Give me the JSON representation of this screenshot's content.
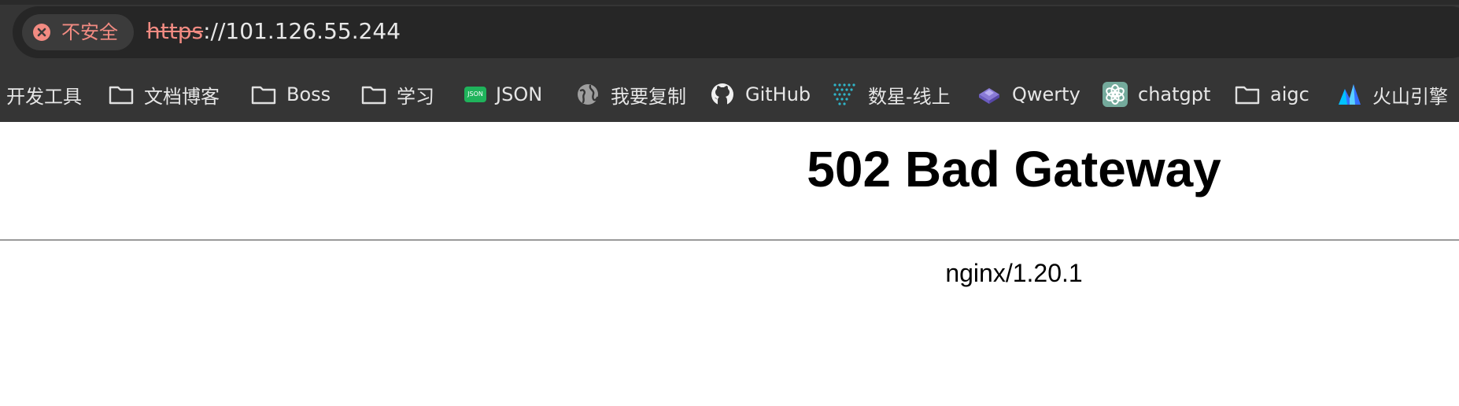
{
  "address_bar": {
    "security_label": "不安全",
    "url_scheme": "https",
    "url_rest": "://101.126.55.244"
  },
  "bookmarks": [
    {
      "label": "开发工具",
      "icon": "none"
    },
    {
      "label": "文档博客",
      "icon": "folder-icon"
    },
    {
      "label": "Boss",
      "icon": "folder-icon"
    },
    {
      "label": "学习",
      "icon": "folder-icon"
    },
    {
      "label": "JSON",
      "icon": "json-icon",
      "badge": "JSON"
    },
    {
      "label": "我要复制",
      "icon": "globe-icon"
    },
    {
      "label": "GitHub",
      "icon": "github-icon"
    },
    {
      "label": "数星-线上",
      "icon": "dots-grid-icon"
    },
    {
      "label": "Qwerty",
      "icon": "keycap-icon"
    },
    {
      "label": "chatgpt",
      "icon": "chatgpt-icon"
    },
    {
      "label": "aigc",
      "icon": "folder-icon"
    },
    {
      "label": "火山引擎",
      "icon": "volcano-icon"
    }
  ],
  "page": {
    "heading": "502 Bad Gateway",
    "server": "nginx/1.20.1"
  },
  "colors": {
    "browser_chrome": "#353535",
    "omnibox": "#262626",
    "insecure_red": "#f28b82",
    "json_green": "#1fb35b",
    "chatgpt_teal": "#74aa9c",
    "volcano_blue": "#3370ff"
  }
}
